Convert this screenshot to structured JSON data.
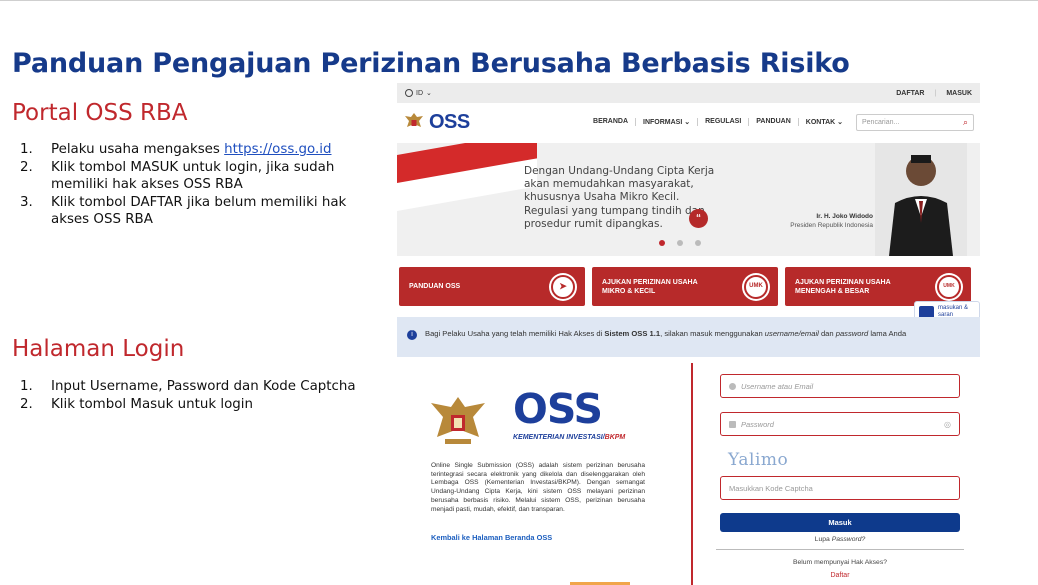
{
  "slide": {
    "title": "Panduan Pengajuan Perizinan Berusaha Berbasis Risiko",
    "section1": {
      "heading": "Portal OSS RBA",
      "steps": [
        {
          "num": "1.",
          "text": "Pelaku usaha mengakses ",
          "link": "https://oss.go.id"
        },
        {
          "num": "2.",
          "text": "Klik tombol MASUK untuk login, jika sudah memiliki hak akses OSS RBA"
        },
        {
          "num": "3.",
          "text": "Klik tombol DAFTAR jika belum memiliki hak akses OSS RBA"
        }
      ]
    },
    "section2": {
      "heading": "Halaman Login",
      "steps": [
        {
          "num": "1.",
          "text": "Input Username, Password dan Kode Captcha"
        },
        {
          "num": "2.",
          "text": "Klik tombol Masuk untuk login"
        }
      ]
    }
  },
  "site": {
    "topbar": {
      "language": "ID",
      "daftar": "DAFTAR",
      "masuk": "MASUK"
    },
    "logo_text": "OSS",
    "nav": [
      "BERANDA",
      "INFORMASI ⌄",
      "REGULASI",
      "PANDUAN",
      "KONTAK ⌄"
    ],
    "search_placeholder": "Pencarian...",
    "banner": {
      "quote": "Dengan Undang-Undang Cipta Kerja akan memudahkan masyarakat, khususnya Usaha Mikro Kecil. Regulasi yang tumpang tindih dan prosedur rumit dipangkas.",
      "name": "Ir. H. Joko Widodo",
      "title": "Presiden Republik Indonesia"
    },
    "cards": [
      {
        "label": "PANDUAN OSS",
        "icon": "compass-icon"
      },
      {
        "label": "AJUKAN PERIZINAN USAHA MIKRO & KECIL",
        "icon": "umk-icon"
      },
      {
        "label": "AJUKAN PERIZINAN USAHA MENENGAH & BESAR",
        "icon": "non-umk-icon"
      }
    ],
    "feedback": "masukan & saran",
    "info": {
      "part1": "Bagi Pelaku Usaha yang telah memiliki Hak Akses di ",
      "bold": "Sistem OSS 1.1",
      "part2": ", silakan masuk menggunakan ",
      "italic1": "username/email",
      "part3": " dan ",
      "italic2": "password",
      "part4": " lama Anda"
    },
    "login": {
      "big_logo": "OSS",
      "kementerian": "KEMENTERIAN INVESTASI/",
      "bkpm": "BKPM",
      "description": "Online Single Submission (OSS) adalah sistem perizinan berusaha terintegrasi secara elektronik yang dikelola dan diselenggarakan oleh Lembaga OSS (Kementerian Investasi/BKPM). Dengan semangat Undang-Undang Cipta Kerja, kini sistem OSS melayani perizinan berusaha berbasis risiko. Melalui sistem OSS, perizinan berusaha menjadi pasti, mudah, efektif, dan transparan.",
      "back_link": "Kembali ke Halaman Beranda OSS",
      "username_placeholder": "Username atau Email",
      "password_placeholder": "Password",
      "captcha_text": "Yalimo",
      "captcha_placeholder": "Masukkan Kode Captcha",
      "submit": "Masuk",
      "lupa": "Lupa ",
      "lupa_italic": "Password?",
      "no_account": "Belum mempunyai Hak Akses?",
      "register": "Daftar"
    }
  },
  "colors": {
    "title_blue": "#163a8a",
    "heading_red": "#c0282d",
    "brand_blue": "#1d3f9b",
    "card_red": "#b72a2a"
  }
}
